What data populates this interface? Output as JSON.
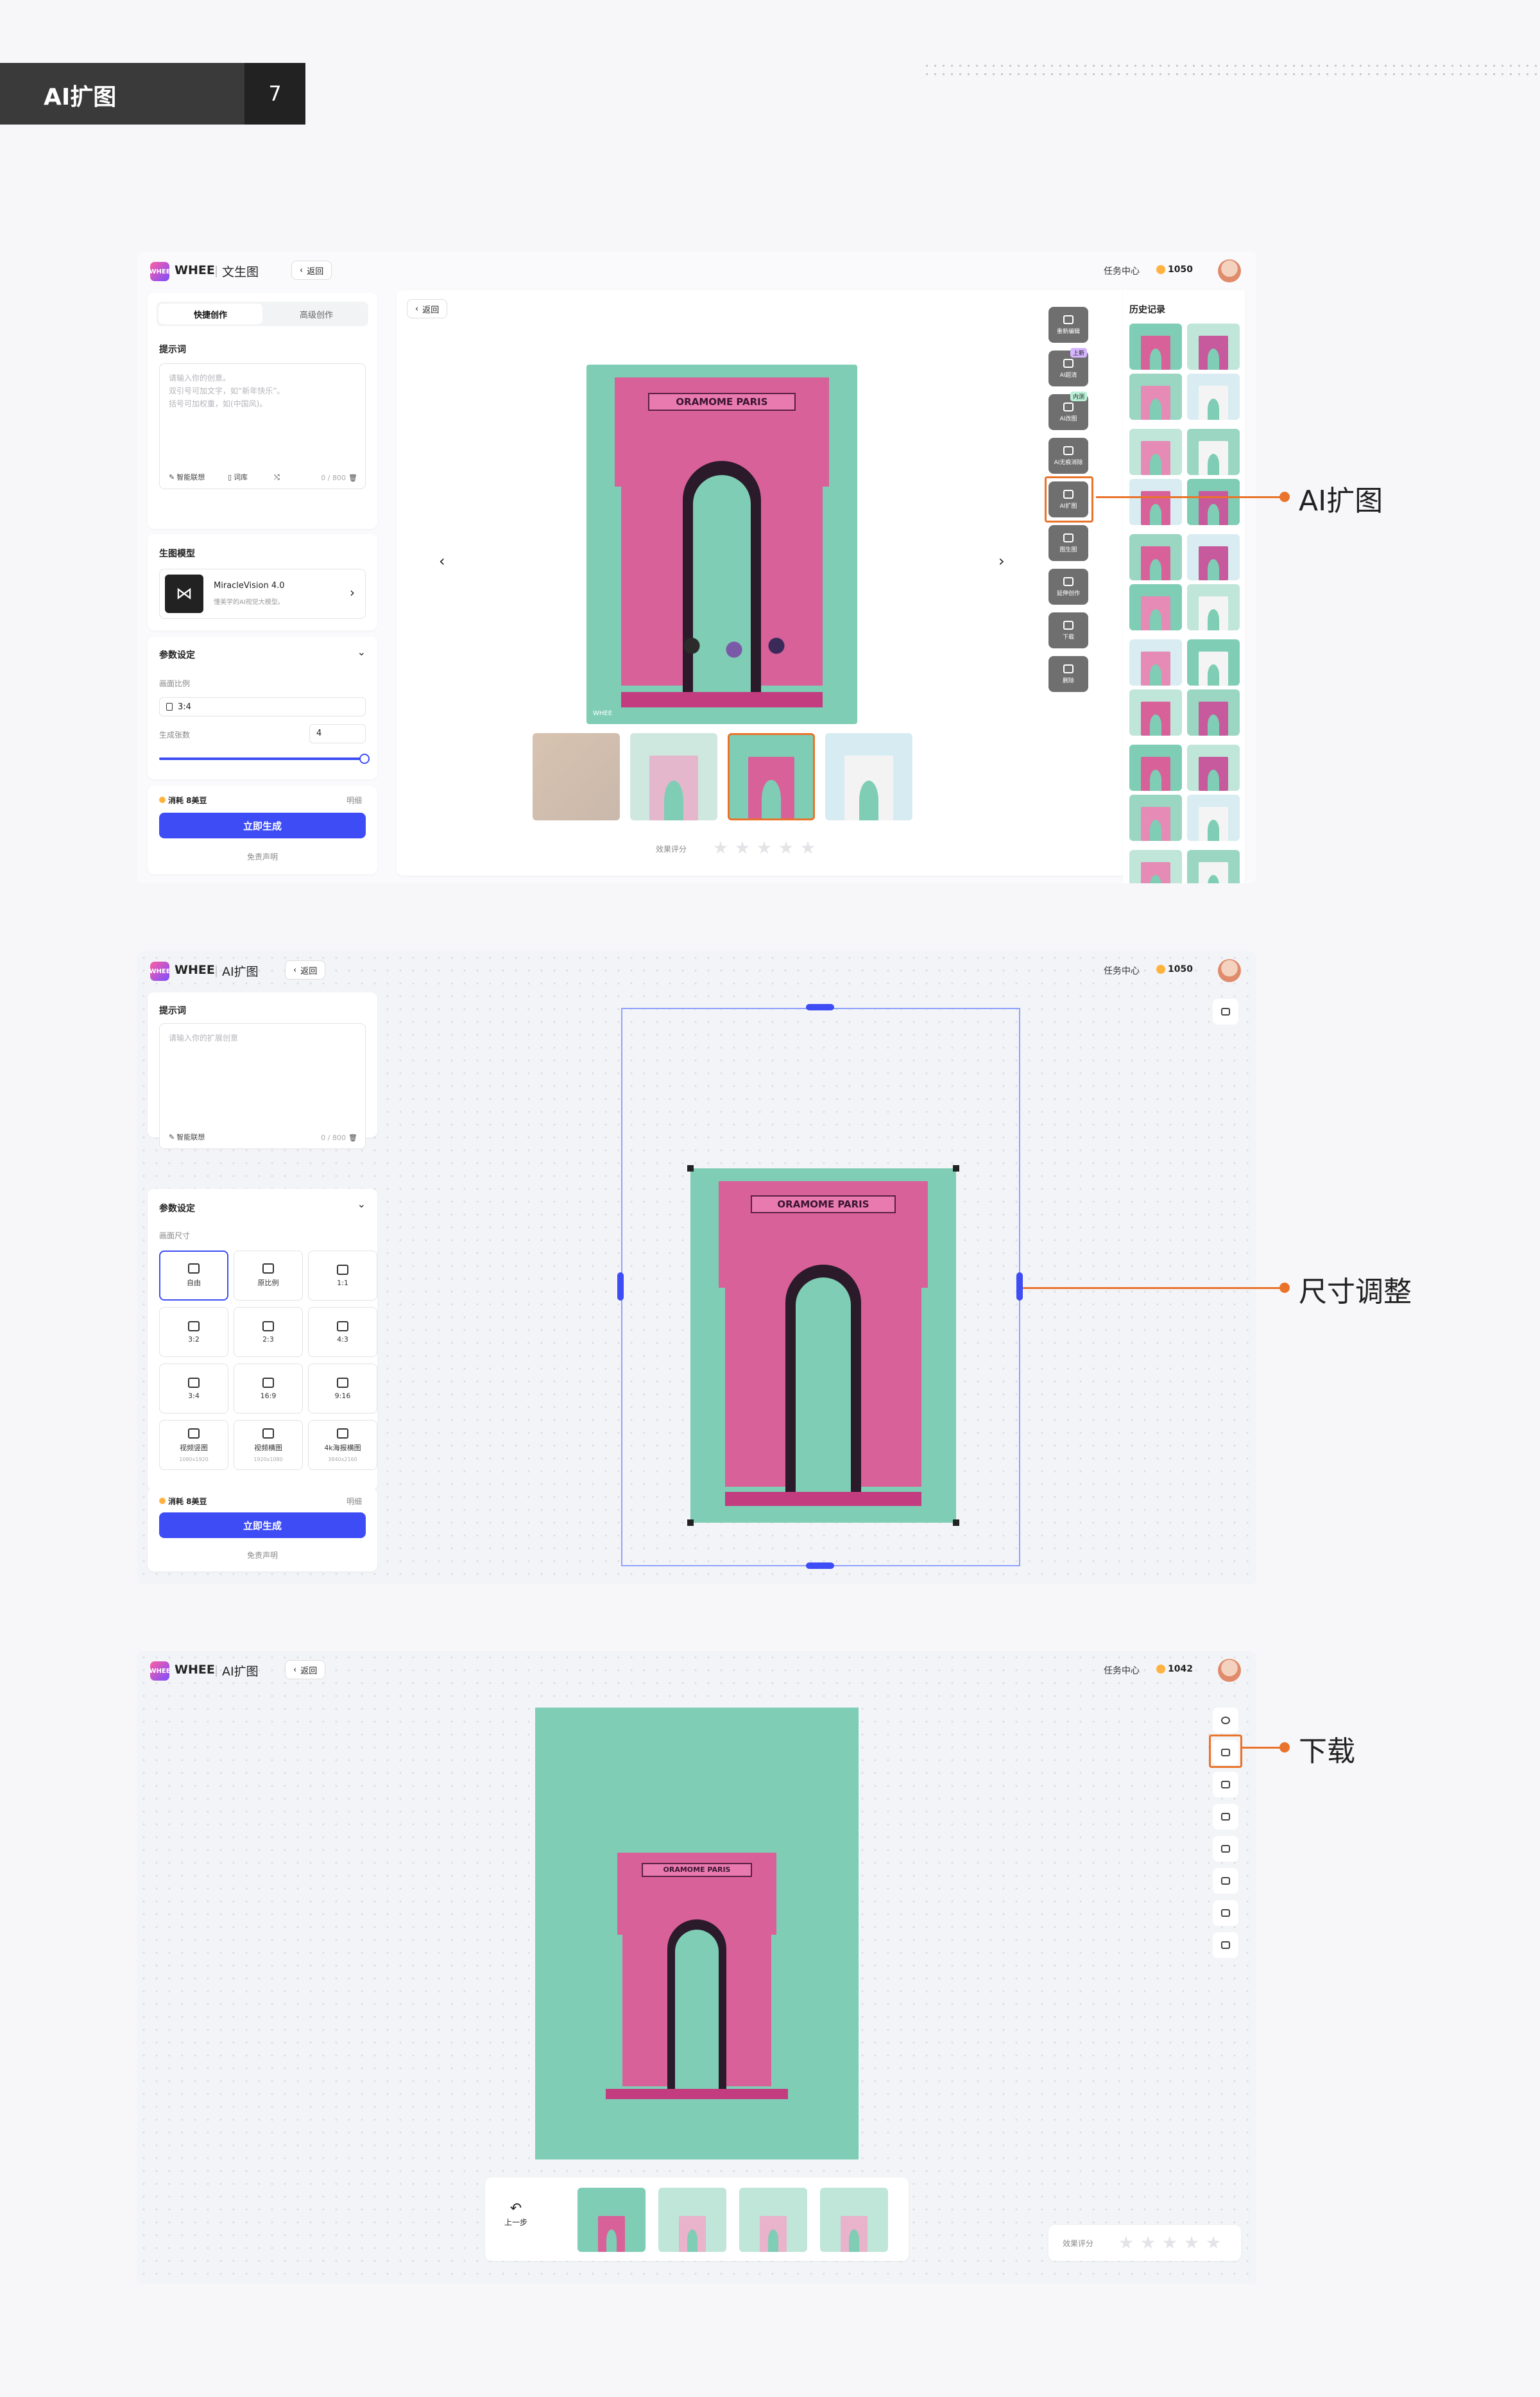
{
  "section": {
    "title": "AI扩图",
    "number": "7"
  },
  "app": {
    "brand": "WHEE",
    "logo_text": "WHEE",
    "back_label": "返回",
    "task_center": "任务中心"
  },
  "shot1": {
    "module": "文生图",
    "coins": "1050",
    "tabs": [
      "快捷创作",
      "高级创作"
    ],
    "prompt_label": "提示词",
    "prompt_placeholder_1": "请输入你的创意。",
    "prompt_placeholder_2": "双引号可加文字，如“新年快乐”。",
    "prompt_placeholder_3": "括号可加权重，如(中国风)。",
    "smart_assoc": "智能联想",
    "lexicon": "词库",
    "char_count": "0 / 800",
    "model_label": "生图模型",
    "model_name": "MiracleVision 4.0",
    "model_desc": "懂美学的AI视觉大模型。",
    "params_label": "参数设定",
    "ratio_label": "画面比例",
    "ratio_value": "3:4",
    "count_label": "生成张数",
    "count_value": "4",
    "cost": "消耗 8美豆",
    "detail": "明细",
    "generate": "立即生成",
    "disclaimer": "免责声明",
    "canvas_back": "返回",
    "poster_title": "ORAMOME PARIS",
    "watermark": "WHEE",
    "rating_label": "效果评分",
    "tools": [
      {
        "label": "重新编辑",
        "badge": ""
      },
      {
        "label": "AI超清",
        "badge": "上新"
      },
      {
        "label": "AI改图",
        "badge": "内测"
      },
      {
        "label": "AI无痕消除",
        "badge": ""
      },
      {
        "label": "AI扩图",
        "badge": ""
      },
      {
        "label": "图生图",
        "badge": ""
      },
      {
        "label": "延伸创作",
        "badge": ""
      },
      {
        "label": "下载",
        "badge": ""
      },
      {
        "label": "删除",
        "badge": ""
      }
    ],
    "badge_colors": {
      "new": "#d6b6ff",
      "beta": "#b9f0d6"
    },
    "history_label": "历史记录"
  },
  "shot2": {
    "module": "AI扩图",
    "coins": "1050",
    "prompt_label": "提示词",
    "prompt_placeholder": "请输入你的扩展创意",
    "smart_assoc": "智能联想",
    "char_count": "0 / 800",
    "params_label": "参数设定",
    "size_label": "画面尺寸",
    "sizes": [
      {
        "label": "自由",
        "sub": ""
      },
      {
        "label": "原比例",
        "sub": ""
      },
      {
        "label": "1:1",
        "sub": ""
      },
      {
        "label": "3:2",
        "sub": ""
      },
      {
        "label": "2:3",
        "sub": ""
      },
      {
        "label": "4:3",
        "sub": ""
      },
      {
        "label": "3:4",
        "sub": ""
      },
      {
        "label": "16:9",
        "sub": ""
      },
      {
        "label": "9:16",
        "sub": ""
      },
      {
        "label": "视频竖图",
        "sub": "1080x1920"
      },
      {
        "label": "视频横图",
        "sub": "1920x1080"
      },
      {
        "label": "4k海报横图",
        "sub": "3840x2160"
      }
    ],
    "cost": "消耗 8美豆",
    "detail": "明细",
    "generate": "立即生成",
    "disclaimer": "免责声明",
    "poster_title": "ORAMOME PARIS"
  },
  "shot3": {
    "module": "AI扩图",
    "coins": "1042",
    "undo": "上一步",
    "rating_label": "效果评分",
    "poster_title": "ORAMOME PARIS"
  },
  "callouts": {
    "outpaint": "AI扩图",
    "resize": "尺寸调整",
    "download": "下载"
  },
  "colors": {
    "accent": "#e9732a",
    "primary": "#3d4cf5",
    "mint": "#7fcdb5",
    "pink": "#d9619a",
    "handle": "#3d4cf5"
  }
}
